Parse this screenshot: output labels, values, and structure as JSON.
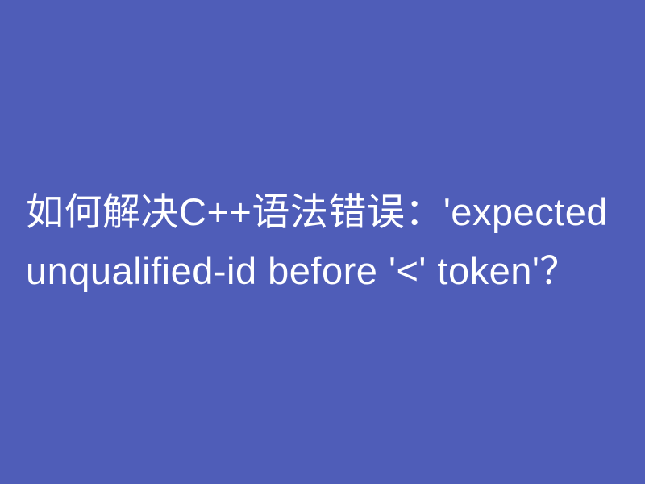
{
  "heading": {
    "text": "如何解决C++语法错误：'expected unqualified-id before '<' token'？"
  }
}
